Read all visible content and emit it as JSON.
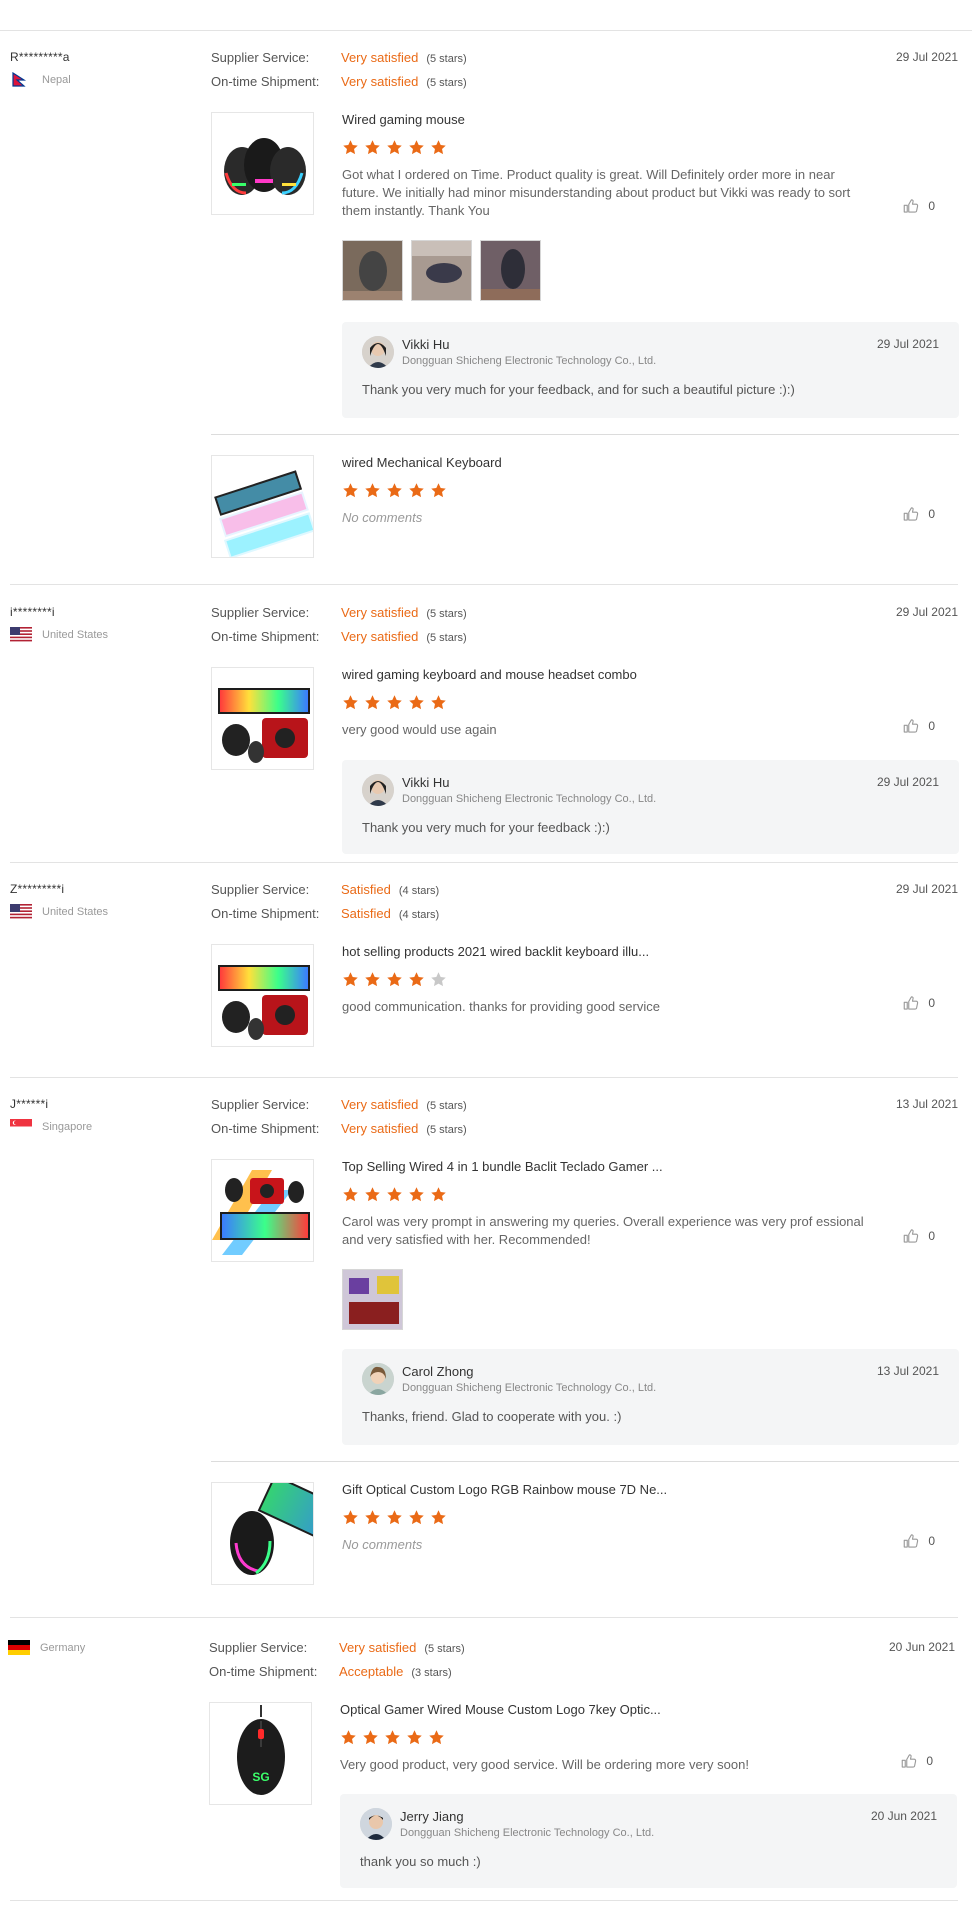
{
  "labels": {
    "supplier_service": "Supplier Service:",
    "on_time_shipment": "On-time Shipment:",
    "no_comments": "No comments"
  },
  "colors": {
    "accent": "#ea6a16",
    "star_empty": "#c8c8c8"
  },
  "reviews": [
    {
      "reviewer": "R*********a",
      "country": "Nepal",
      "flag_icon": "nepal-flag-icon",
      "date": "29 Jul 2021",
      "supplier_service": "Very satisfied",
      "supplier_service_stars": "(5 stars)",
      "on_time_shipment": "Very satisfied",
      "on_time_shipment_stars": "(5 stars)",
      "products": [
        {
          "name": "Wired gaming mouse",
          "rating": 5,
          "comment": "Got what I ordered on Time. Product quality is great. Will Definitely order more in near future. We initially had minor misunderstanding about product but Vikki was ready to sort them instantly. Thank You",
          "likes": "0",
          "attachments": 3,
          "reply": {
            "name": "Vikki Hu",
            "company": "Dongguan Shicheng Electronic Technology Co., Ltd.",
            "date": "29 Jul 2021",
            "text": "Thank you very much for your feedback, and for such a beautiful picture :):)"
          }
        },
        {
          "name": "wired Mechanical Keyboard",
          "rating": 5,
          "comment": "No comments",
          "likes": "0"
        }
      ]
    },
    {
      "reviewer": "i********i",
      "country": "United States",
      "flag_icon": "us-flag-icon",
      "date": "29 Jul 2021",
      "supplier_service": "Very satisfied",
      "supplier_service_stars": "(5 stars)",
      "on_time_shipment": "Very satisfied",
      "on_time_shipment_stars": "(5 stars)",
      "products": [
        {
          "name": "wired gaming keyboard and mouse headset combo",
          "rating": 5,
          "comment": "very good would use again",
          "likes": "0",
          "reply": {
            "name": "Vikki Hu",
            "company": "Dongguan Shicheng Electronic Technology Co., Ltd.",
            "date": "29 Jul 2021",
            "text": "Thank you very much for your feedback :):)"
          }
        }
      ]
    },
    {
      "reviewer": "Z*********i",
      "country": "United States",
      "flag_icon": "us-flag-icon",
      "date": "29 Jul 2021",
      "supplier_service": "Satisfied",
      "supplier_service_stars": "(4 stars)",
      "on_time_shipment": "Satisfied",
      "on_time_shipment_stars": "(4 stars)",
      "products": [
        {
          "name": "hot selling products 2021 wired backlit keyboard illu...",
          "rating": 4,
          "comment": "good communication. thanks for providing good service",
          "likes": "0"
        }
      ]
    },
    {
      "reviewer": "J******i",
      "country": "Singapore",
      "flag_icon": "singapore-flag-icon",
      "date": "13 Jul 2021",
      "supplier_service": "Very satisfied",
      "supplier_service_stars": "(5 stars)",
      "on_time_shipment": "Very satisfied",
      "on_time_shipment_stars": "(5 stars)",
      "products": [
        {
          "name": "Top Selling Wired 4 in 1 bundle Baclit Teclado Gamer ...",
          "rating": 5,
          "comment": "Carol was very prompt in answering my queries. Overall experience was very prof essional and very satisfied with her. Recommended!",
          "likes": "0",
          "attachments": 1,
          "reply": {
            "name": "Carol Zhong",
            "company": "Dongguan Shicheng Electronic Technology Co., Ltd.",
            "date": "13 Jul 2021",
            "text": "Thanks, friend. Glad to cooperate with you. :)"
          }
        },
        {
          "name": "Gift Optical Custom Logo RGB Rainbow mouse 7D Ne...",
          "rating": 5,
          "comment": "No comments",
          "likes": "0"
        }
      ]
    },
    {
      "reviewer": "",
      "country": "Germany",
      "flag_icon": "germany-flag-icon",
      "date": "20 Jun 2021",
      "supplier_service": "Very satisfied",
      "supplier_service_stars": "(5 stars)",
      "on_time_shipment": "Acceptable",
      "on_time_shipment_stars": "(3 stars)",
      "products": [
        {
          "name": "Optical Gamer Wired Mouse Custom Logo 7key Optic...",
          "rating": 5,
          "comment": "Very good product, very good service. Will be ordering more very soon!",
          "likes": "0",
          "reply": {
            "name": "Jerry Jiang",
            "company": "Dongguan Shicheng Electronic Technology Co., Ltd.",
            "date": "20 Jun 2021",
            "text": "thank you so much :)"
          }
        }
      ]
    }
  ]
}
